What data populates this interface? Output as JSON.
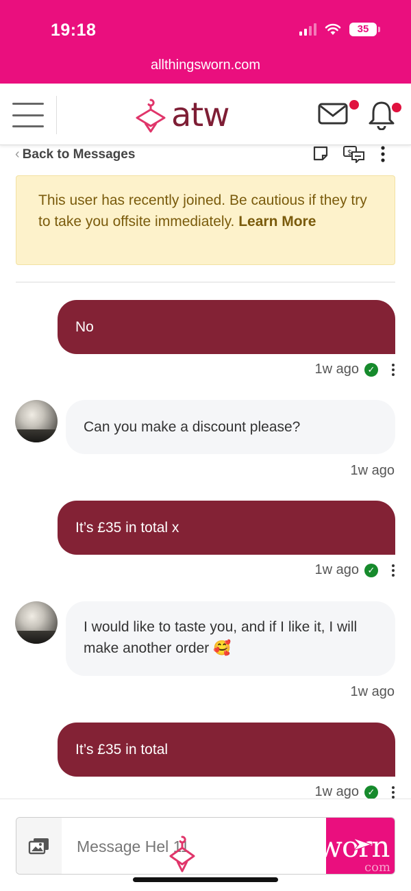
{
  "status_bar": {
    "time": "19:18",
    "battery": "35"
  },
  "browser": {
    "url": "allthingsworn.com"
  },
  "header": {
    "logo_text": "atw",
    "icons": [
      "menu-icon",
      "hanger-icon",
      "mail-icon",
      "bell-icon"
    ],
    "brand_color": "#7e1e35",
    "accent_color": "#ea0f7e"
  },
  "nav": {
    "back_label": "Back to Messages",
    "icons": [
      "note-icon",
      "offer-icon",
      "more-icon"
    ]
  },
  "warning": {
    "text": "This user has recently joined. Be cautious if they try to take you offsite immediately.",
    "link": "Learn More"
  },
  "messages": [
    {
      "direction": "out",
      "text": "No",
      "time": "1w ago",
      "delivered": true
    },
    {
      "direction": "in",
      "text": "Can you make a discount please?",
      "time": "1w ago"
    },
    {
      "direction": "out",
      "text": "It’s £35 in total x",
      "time": "1w ago",
      "delivered": true
    },
    {
      "direction": "in",
      "text": "I would like to taste you, and if I like it, I will make another order 🥰",
      "time": "1w ago"
    },
    {
      "direction": "out",
      "text": "It’s £35 in total",
      "time": "1w ago",
      "delivered": true
    }
  ],
  "composer": {
    "placeholder": "Message Hel 11",
    "send_brand_text": "worn",
    "send_brand_sub": "com"
  }
}
